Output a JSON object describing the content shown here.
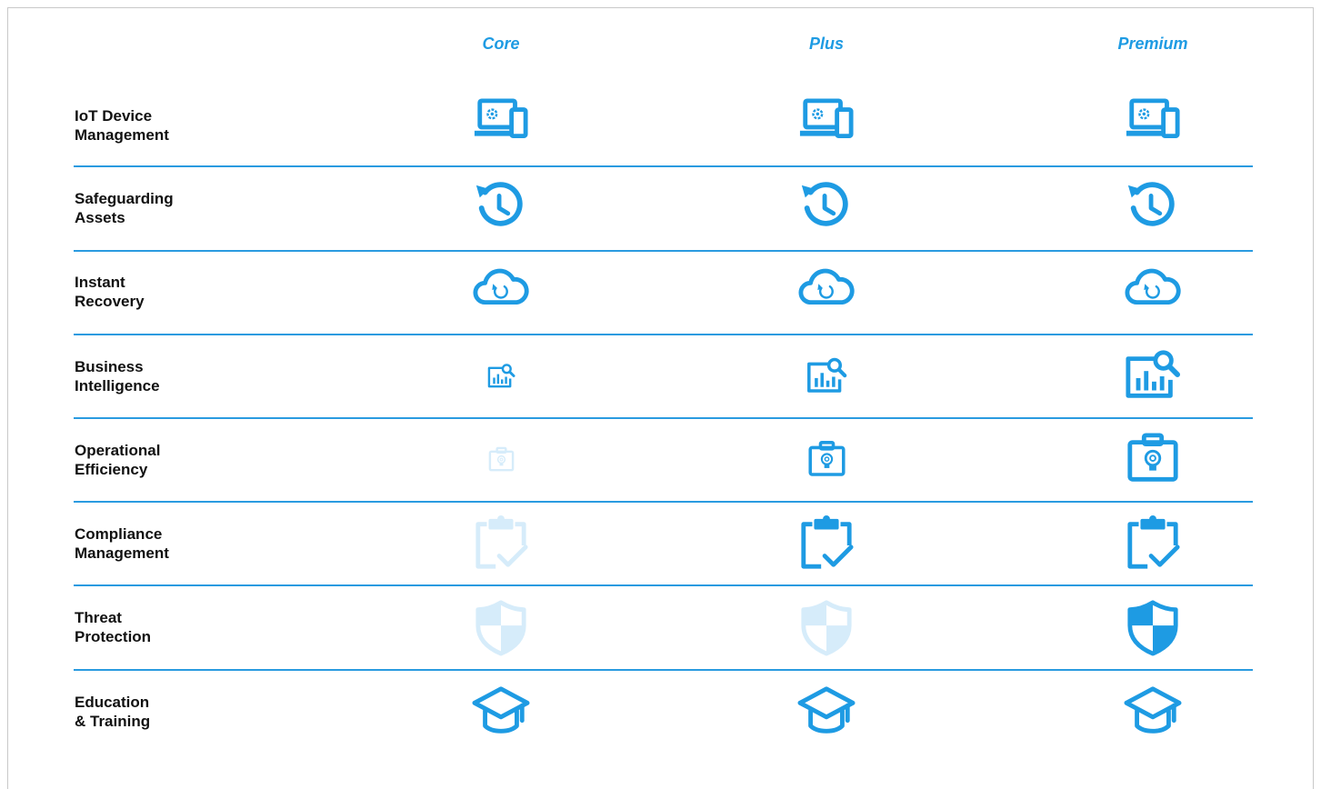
{
  "colors": {
    "accent": "#1e9be3",
    "divider": "#2a9be0",
    "label": "#111111",
    "faded": "#d6ecfa"
  },
  "tiers": [
    "Core",
    "Plus",
    "Premium"
  ],
  "rows": [
    {
      "label": "IoT Device\nManagement",
      "icon": "iot-device-icon",
      "cells": [
        {
          "state": "included",
          "size": "full"
        },
        {
          "state": "included",
          "size": "full"
        },
        {
          "state": "included",
          "size": "full"
        }
      ]
    },
    {
      "label": "Safeguarding\nAssets",
      "icon": "history-clock-icon",
      "cells": [
        {
          "state": "included",
          "size": "full"
        },
        {
          "state": "included",
          "size": "full"
        },
        {
          "state": "included",
          "size": "full"
        }
      ]
    },
    {
      "label": "Instant\nRecovery",
      "icon": "cloud-restore-icon",
      "cells": [
        {
          "state": "included",
          "size": "full"
        },
        {
          "state": "included",
          "size": "full"
        },
        {
          "state": "included",
          "size": "full"
        }
      ]
    },
    {
      "label": "Business\nIntelligence",
      "icon": "analytics-search-icon",
      "cells": [
        {
          "state": "included",
          "size": "small"
        },
        {
          "state": "included",
          "size": "medium"
        },
        {
          "state": "included",
          "size": "full"
        }
      ]
    },
    {
      "label": "Operational\nEfficiency",
      "icon": "briefcase-idea-icon",
      "cells": [
        {
          "state": "excluded",
          "size": "small"
        },
        {
          "state": "included",
          "size": "medium"
        },
        {
          "state": "included",
          "size": "full"
        }
      ]
    },
    {
      "label": "Compliance\nManagement",
      "icon": "clipboard-check-icon",
      "cells": [
        {
          "state": "excluded",
          "size": "full"
        },
        {
          "state": "included",
          "size": "full"
        },
        {
          "state": "included",
          "size": "full"
        }
      ]
    },
    {
      "label": "Threat\nProtection",
      "icon": "shield-icon",
      "cells": [
        {
          "state": "excluded",
          "size": "full"
        },
        {
          "state": "excluded",
          "size": "full"
        },
        {
          "state": "included",
          "size": "full"
        }
      ]
    },
    {
      "label": "Education\n& Training",
      "icon": "graduation-cap-icon",
      "cells": [
        {
          "state": "included",
          "size": "full"
        },
        {
          "state": "included",
          "size": "full"
        },
        {
          "state": "included",
          "size": "full"
        }
      ]
    }
  ]
}
